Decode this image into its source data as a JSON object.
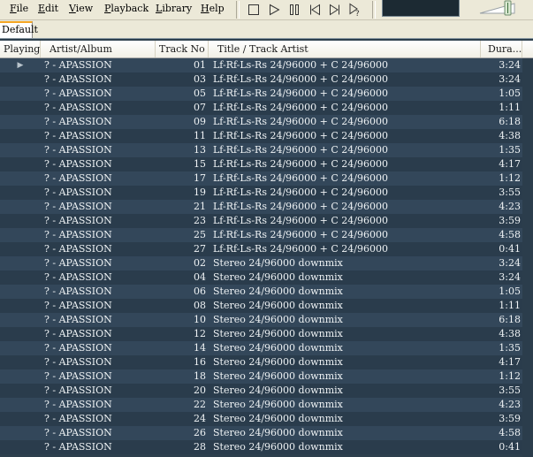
{
  "menu": [
    {
      "label_u": "F",
      "label_rest": "ile"
    },
    {
      "label_u": "E",
      "label_rest": "dit"
    },
    {
      "label_u": "V",
      "label_rest": "iew"
    },
    {
      "label_u": "P",
      "label_rest": "layback"
    },
    {
      "label_u": "L",
      "label_rest": "ibrary"
    },
    {
      "label_u": "H",
      "label_rest": "elp"
    }
  ],
  "toolbar": {
    "icons": [
      "stop-icon",
      "play-icon",
      "pause-icon",
      "previous-icon",
      "next-icon",
      "random-icon"
    ]
  },
  "tab": {
    "label": "Default"
  },
  "columns": {
    "playing": "Playing",
    "artist": "Artist/Album",
    "track": "Track No",
    "title": "Title / Track Artist",
    "duration": "Dura..."
  },
  "colors": {
    "row_odd": "#33475a",
    "row_even": "#2a3c4c",
    "text": "#eef2f4",
    "tab_accent": "#f5a623"
  },
  "rows": [
    {
      "playing": "▶",
      "artist": "? - APASSION",
      "track": "01",
      "title": "Lf-Rf-Ls-Rs 24/96000 + C 24/96000",
      "duration": "3:24"
    },
    {
      "playing": "",
      "artist": "? - APASSION",
      "track": "03",
      "title": "Lf-Rf-Ls-Rs 24/96000 + C 24/96000",
      "duration": "3:24"
    },
    {
      "playing": "",
      "artist": "? - APASSION",
      "track": "05",
      "title": "Lf-Rf-Ls-Rs 24/96000 + C 24/96000",
      "duration": "1:05"
    },
    {
      "playing": "",
      "artist": "? - APASSION",
      "track": "07",
      "title": "Lf-Rf-Ls-Rs 24/96000 + C 24/96000",
      "duration": "1:11"
    },
    {
      "playing": "",
      "artist": "? - APASSION",
      "track": "09",
      "title": "Lf-Rf-Ls-Rs 24/96000 + C 24/96000",
      "duration": "6:18"
    },
    {
      "playing": "",
      "artist": "? - APASSION",
      "track": "11",
      "title": "Lf-Rf-Ls-Rs 24/96000 + C 24/96000",
      "duration": "4:38"
    },
    {
      "playing": "",
      "artist": "? - APASSION",
      "track": "13",
      "title": "Lf-Rf-Ls-Rs 24/96000 + C 24/96000",
      "duration": "1:35"
    },
    {
      "playing": "",
      "artist": "? - APASSION",
      "track": "15",
      "title": "Lf-Rf-Ls-Rs 24/96000 + C 24/96000",
      "duration": "4:17"
    },
    {
      "playing": "",
      "artist": "? - APASSION",
      "track": "17",
      "title": "Lf-Rf-Ls-Rs 24/96000 + C 24/96000",
      "duration": "1:12"
    },
    {
      "playing": "",
      "artist": "? - APASSION",
      "track": "19",
      "title": "Lf-Rf-Ls-Rs 24/96000 + C 24/96000",
      "duration": "3:55"
    },
    {
      "playing": "",
      "artist": "? - APASSION",
      "track": "21",
      "title": "Lf-Rf-Ls-Rs 24/96000 + C 24/96000",
      "duration": "4:23"
    },
    {
      "playing": "",
      "artist": "? - APASSION",
      "track": "23",
      "title": "Lf-Rf-Ls-Rs 24/96000 + C 24/96000",
      "duration": "3:59"
    },
    {
      "playing": "",
      "artist": "? - APASSION",
      "track": "25",
      "title": "Lf-Rf-Ls-Rs 24/96000 + C 24/96000",
      "duration": "4:58"
    },
    {
      "playing": "",
      "artist": "? - APASSION",
      "track": "27",
      "title": "Lf-Rf-Ls-Rs 24/96000 + C 24/96000",
      "duration": "0:41"
    },
    {
      "playing": "",
      "artist": "? - APASSION",
      "track": "02",
      "title": "Stereo 24/96000 downmix",
      "duration": "3:24"
    },
    {
      "playing": "",
      "artist": "? - APASSION",
      "track": "04",
      "title": "Stereo 24/96000 downmix",
      "duration": "3:24"
    },
    {
      "playing": "",
      "artist": "? - APASSION",
      "track": "06",
      "title": "Stereo 24/96000 downmix",
      "duration": "1:05"
    },
    {
      "playing": "",
      "artist": "? - APASSION",
      "track": "08",
      "title": "Stereo 24/96000 downmix",
      "duration": "1:11"
    },
    {
      "playing": "",
      "artist": "? - APASSION",
      "track": "10",
      "title": "Stereo 24/96000 downmix",
      "duration": "6:18"
    },
    {
      "playing": "",
      "artist": "? - APASSION",
      "track": "12",
      "title": "Stereo 24/96000 downmix",
      "duration": "4:38"
    },
    {
      "playing": "",
      "artist": "? - APASSION",
      "track": "14",
      "title": "Stereo 24/96000 downmix",
      "duration": "1:35"
    },
    {
      "playing": "",
      "artist": "? - APASSION",
      "track": "16",
      "title": "Stereo 24/96000 downmix",
      "duration": "4:17"
    },
    {
      "playing": "",
      "artist": "? - APASSION",
      "track": "18",
      "title": "Stereo 24/96000 downmix",
      "duration": "1:12"
    },
    {
      "playing": "",
      "artist": "? - APASSION",
      "track": "20",
      "title": "Stereo 24/96000 downmix",
      "duration": "3:55"
    },
    {
      "playing": "",
      "artist": "? - APASSION",
      "track": "22",
      "title": "Stereo 24/96000 downmix",
      "duration": "4:23"
    },
    {
      "playing": "",
      "artist": "? - APASSION",
      "track": "24",
      "title": "Stereo 24/96000 downmix",
      "duration": "3:59"
    },
    {
      "playing": "",
      "artist": "? - APASSION",
      "track": "26",
      "title": "Stereo 24/96000 downmix",
      "duration": "4:58"
    },
    {
      "playing": "",
      "artist": "? - APASSION",
      "track": "28",
      "title": "Stereo 24/96000 downmix",
      "duration": "0:41"
    }
  ]
}
